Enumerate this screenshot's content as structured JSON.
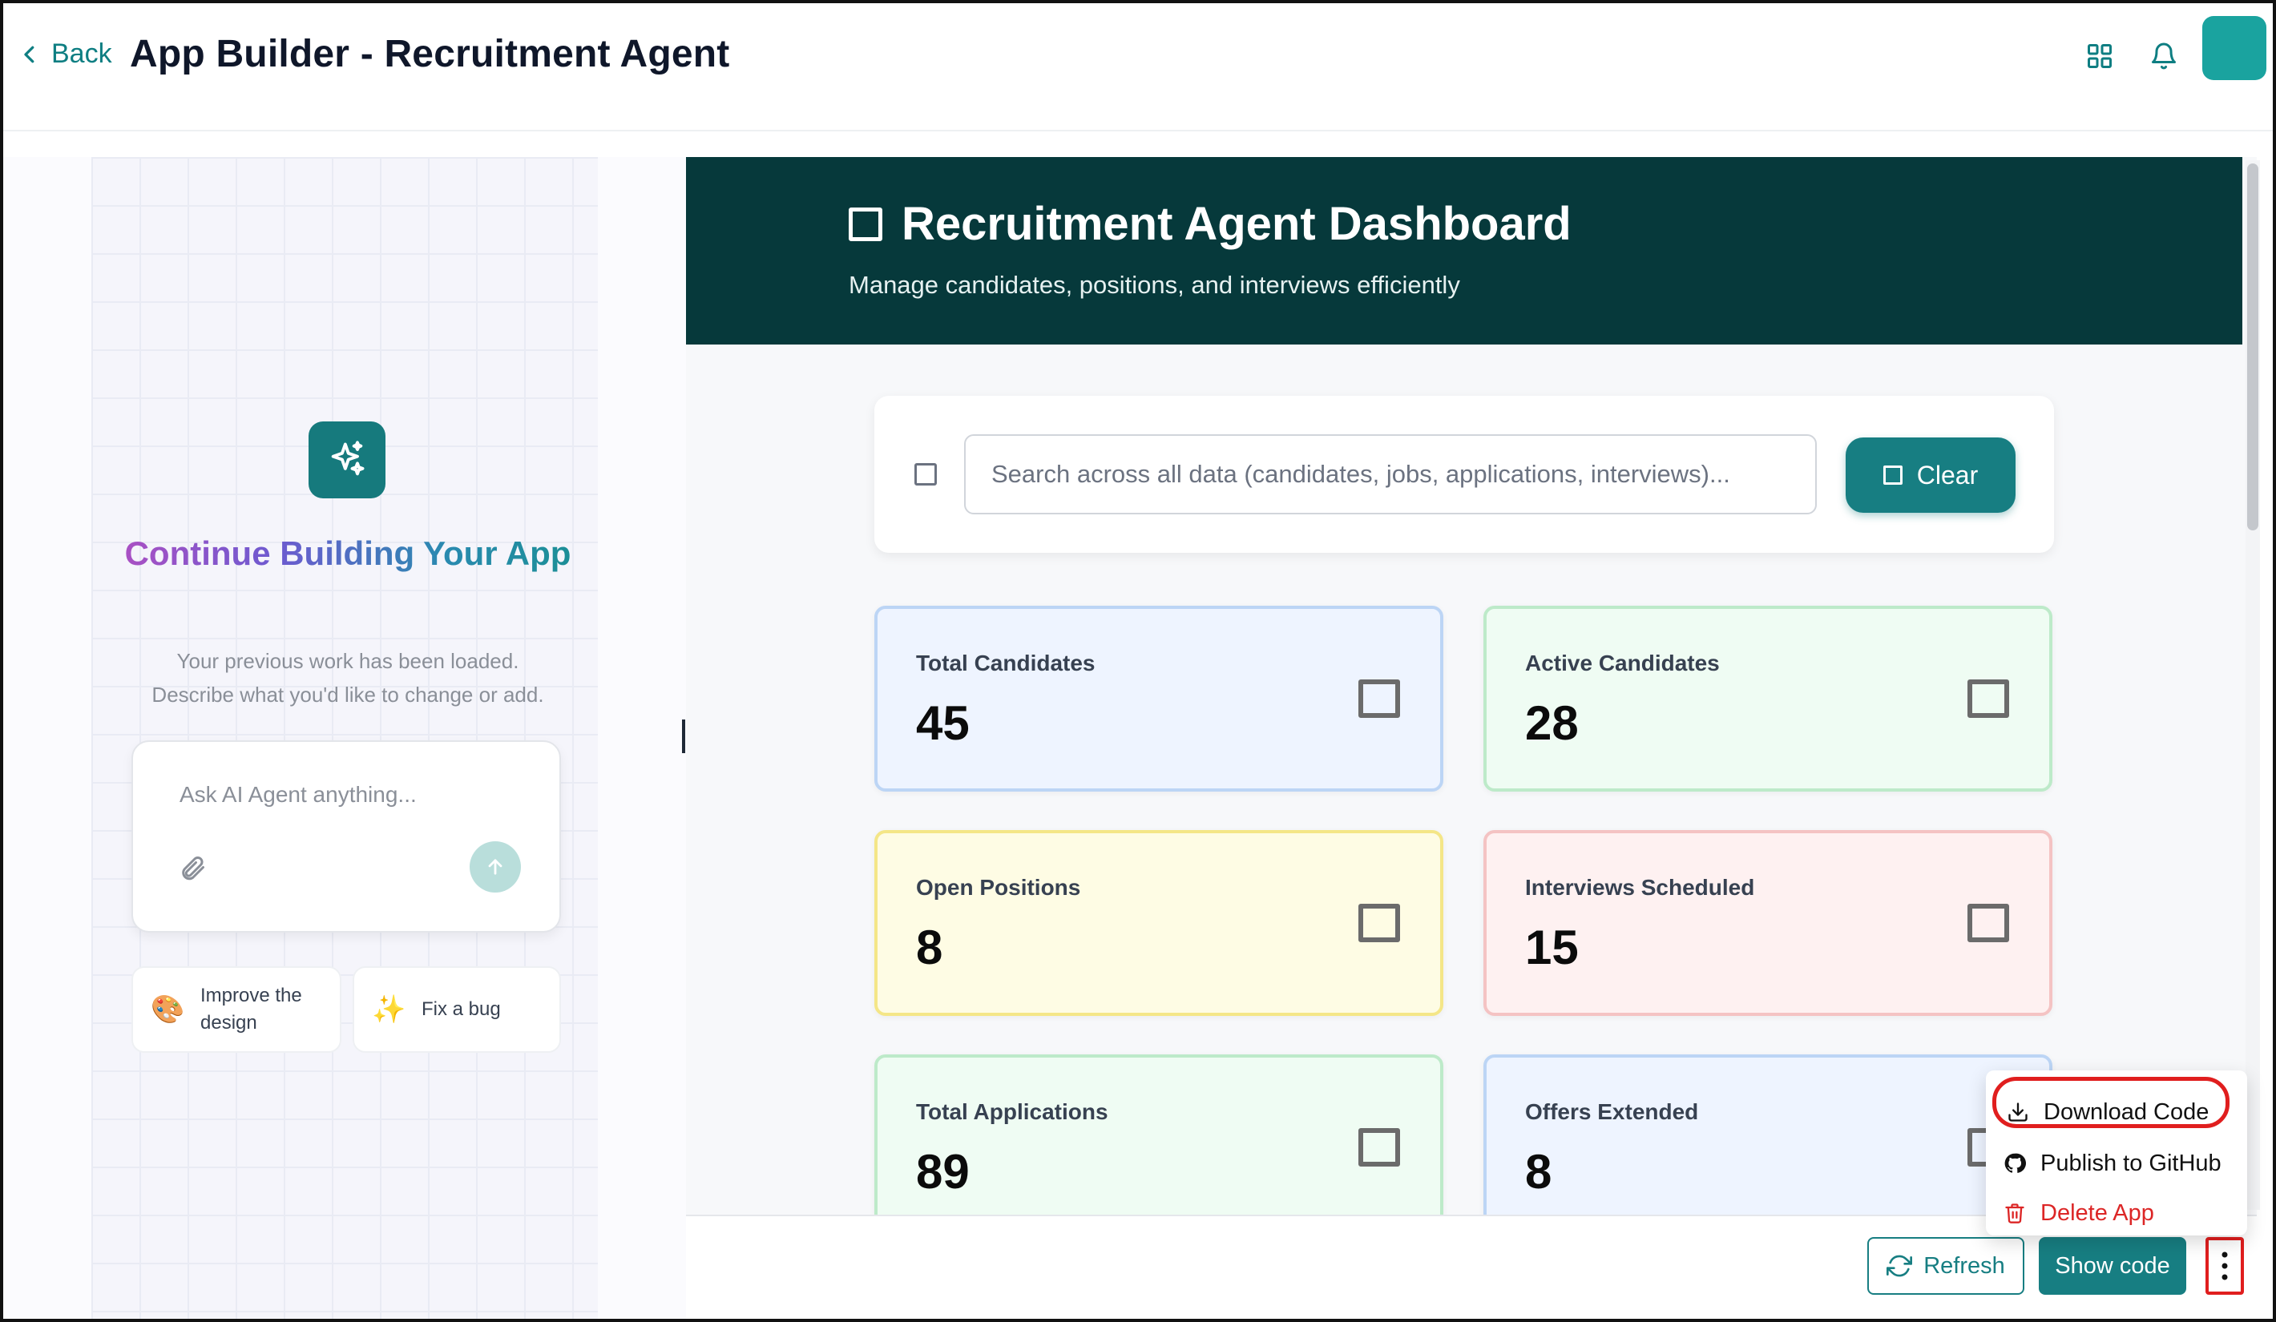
{
  "header": {
    "back_label": "Back",
    "title": "App Builder - Recruitment Agent",
    "accent_color": "#0e7e82",
    "avatar_color": "#1aa39f"
  },
  "builder_panel": {
    "heading": "Continue Building Your App",
    "subtitle_line1": "Your previous work has been loaded.",
    "subtitle_line2": "Describe what you'd like to change or add.",
    "input_placeholder": "Ask AI Agent anything...",
    "suggestions": [
      {
        "emoji": "🎨",
        "label": "Improve the design"
      },
      {
        "emoji": "✨",
        "label": "Fix a bug"
      }
    ]
  },
  "dashboard": {
    "title": "Recruitment Agent Dashboard",
    "subtitle": "Manage candidates, positions, and interviews efficiently",
    "header_color": "#06393b",
    "search_placeholder": "Search across all data (candidates, jobs, applications, interviews)...",
    "clear_label": "Clear",
    "stats": [
      {
        "label": "Total Candidates",
        "value": "45",
        "color": "blue"
      },
      {
        "label": "Active Candidates",
        "value": "28",
        "color": "green"
      },
      {
        "label": "Open Positions",
        "value": "8",
        "color": "yellow"
      },
      {
        "label": "Interviews Scheduled",
        "value": "15",
        "color": "red"
      },
      {
        "label": "Total Applications",
        "value": "89",
        "color": "green"
      },
      {
        "label": "Offers Extended",
        "value": "8",
        "color": "blue"
      }
    ]
  },
  "footer": {
    "refresh_label": "Refresh",
    "show_code_label": "Show code"
  },
  "more_menu": {
    "items": [
      {
        "label": "Download Code",
        "icon": "download-icon"
      },
      {
        "label": "Publish to GitHub",
        "icon": "github-icon"
      },
      {
        "label": "Delete App",
        "icon": "trash-icon",
        "danger": true
      }
    ],
    "highlight_color": "#e01e1e"
  }
}
